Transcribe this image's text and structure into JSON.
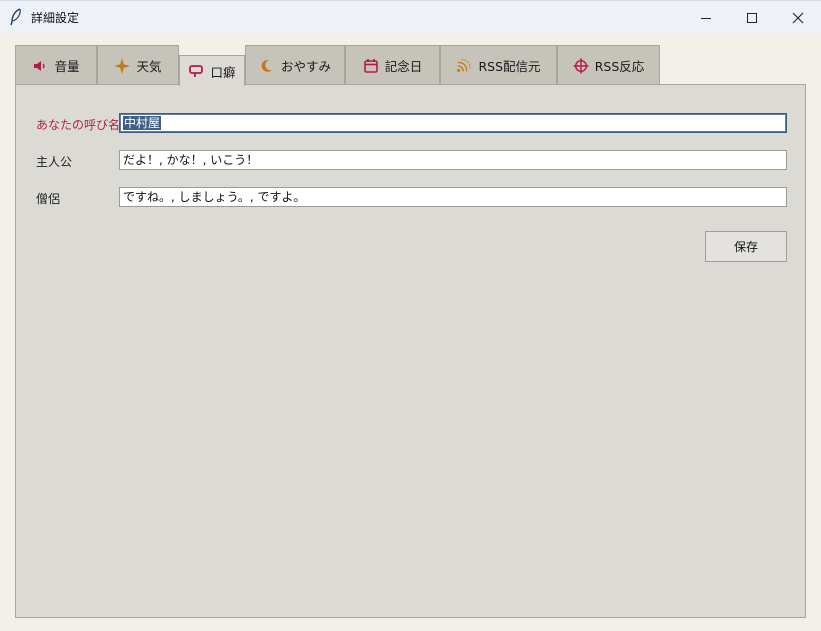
{
  "window": {
    "title": "詳細設定"
  },
  "tabs": [
    {
      "label": "音量",
      "icon": "speaker-icon",
      "active": false
    },
    {
      "label": "天気",
      "icon": "sun-icon",
      "active": false
    },
    {
      "label": "口癖",
      "icon": "speech-bubble-icon",
      "active": true
    },
    {
      "label": "おやすみ",
      "icon": "moon-icon",
      "active": false
    },
    {
      "label": "記念日",
      "icon": "calendar-icon",
      "active": false
    },
    {
      "label": "RSS配信元",
      "icon": "rss-feed-icon",
      "active": false
    },
    {
      "label": "RSS反応",
      "icon": "crosshair-icon",
      "active": false
    }
  ],
  "form": {
    "fields": [
      {
        "label": "あなたの呼び名",
        "value": "中村屋",
        "focused": true
      },
      {
        "label": "主人公",
        "value": "だよ！, かな！, いこう！",
        "focused": false
      },
      {
        "label": "僧侶",
        "value": "ですね。, しましょう。, ですよ。",
        "focused": false
      }
    ],
    "save_label": "保存"
  },
  "colors": {
    "accent_label": "#b1224a",
    "tab_icon_crimson": "#b5194a",
    "tab_icon_amber": "#c47a1c",
    "selection": "#3f5f86"
  }
}
